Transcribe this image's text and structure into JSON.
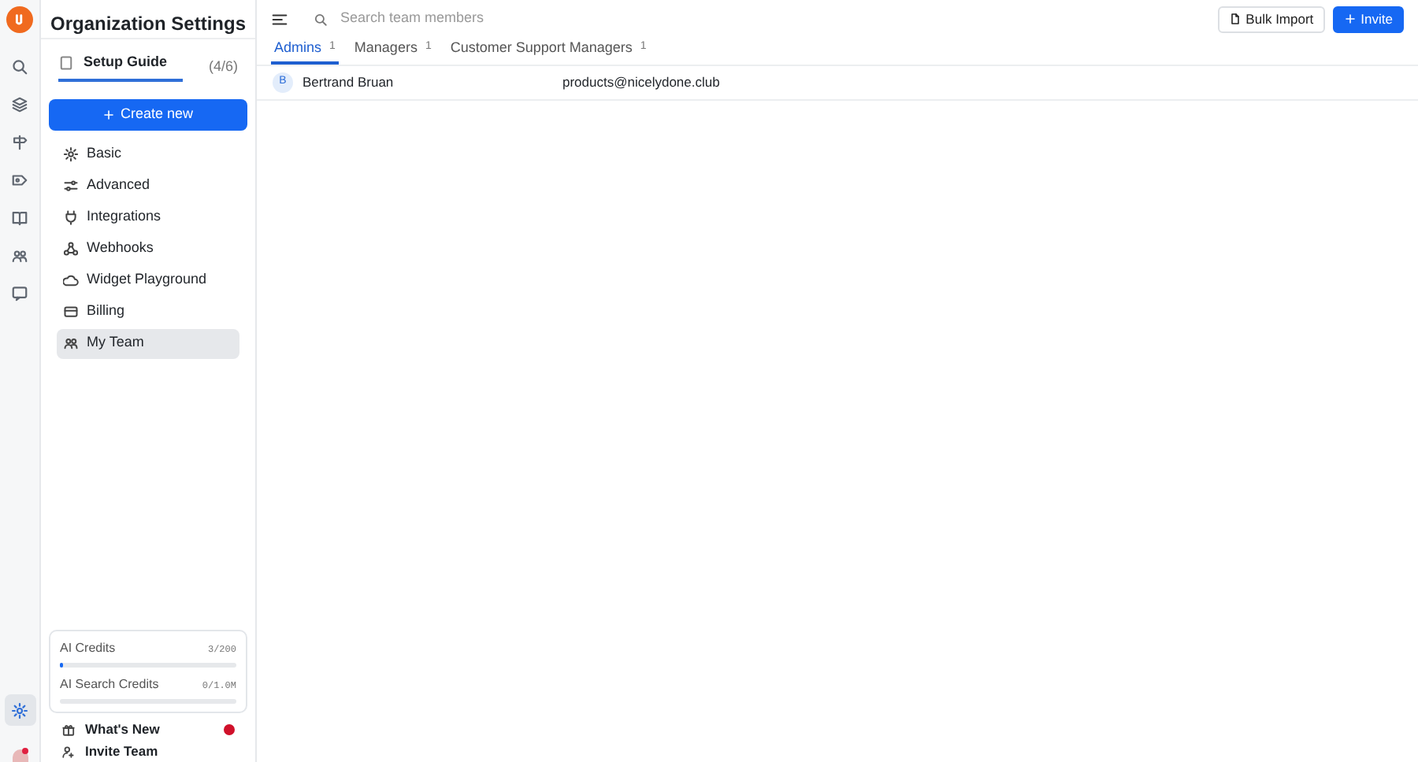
{
  "sidebar": {
    "title": "Organization Settings",
    "setup_guide": {
      "label": "Setup Guide",
      "progress": "(4/6)"
    },
    "create_button": "Create new",
    "items": [
      {
        "label": "Basic",
        "selected": false
      },
      {
        "label": "Advanced",
        "selected": false
      },
      {
        "label": "Integrations",
        "selected": false
      },
      {
        "label": "Webhooks",
        "selected": false
      },
      {
        "label": "Widget Playground",
        "selected": false
      },
      {
        "label": "Billing",
        "selected": false
      },
      {
        "label": "My Team",
        "selected": true
      }
    ],
    "credits": [
      {
        "label": "AI Credits",
        "reading": "3/200",
        "level": 0.015
      },
      {
        "label": "AI Search Credits",
        "reading": "0/1.0M",
        "level": 0
      }
    ],
    "footer_links": [
      {
        "label": "What's New",
        "badge": true
      },
      {
        "label": "Invite Team",
        "badge": false
      }
    ]
  },
  "search": {
    "placeholder": "Search team members"
  },
  "buttons": [
    {
      "label": "Bulk Import",
      "kind": "secondary"
    },
    {
      "label": "Invite",
      "kind": "primary"
    }
  ],
  "tabs": [
    {
      "label": "Admins",
      "count": "1",
      "selected": true
    },
    {
      "label": "Managers",
      "count": "1",
      "selected": false
    },
    {
      "label": "Customer Support Managers",
      "count": "1",
      "selected": false
    }
  ],
  "members": [
    {
      "initial": "B",
      "name": "Bertrand Bruan",
      "email": "products@nicelydone.club"
    }
  ]
}
